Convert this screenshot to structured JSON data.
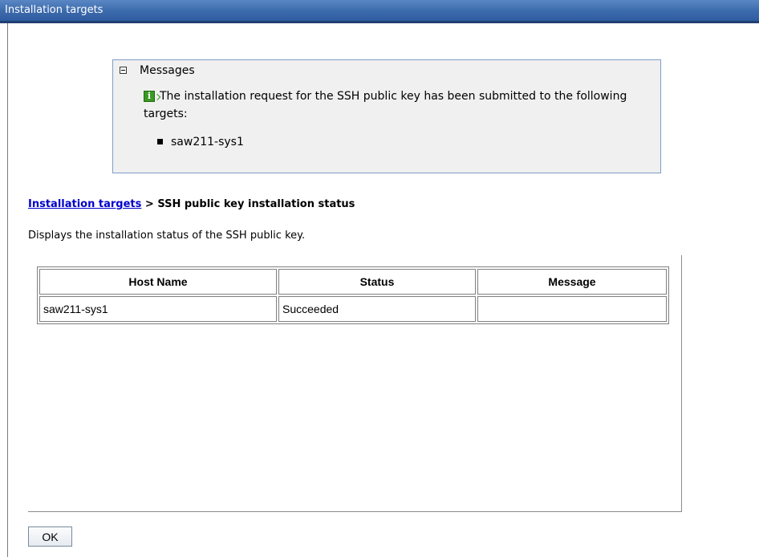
{
  "window": {
    "title": "Installation targets"
  },
  "messages": {
    "heading": "Messages",
    "text": "The installation request for the SSH public key has been submitted to the following targets:",
    "targets": [
      "saw211-sys1"
    ]
  },
  "breadcrumb": {
    "link": "Installation targets",
    "separator": " > ",
    "current": "SSH public key installation status"
  },
  "description": "Displays the installation status of the SSH public key.",
  "table": {
    "columns": [
      "Host Name",
      "Status",
      "Message"
    ],
    "rows": [
      [
        "saw211-sys1",
        "Succeeded",
        ""
      ]
    ]
  },
  "buttons": {
    "ok": "OK"
  },
  "colors": {
    "title_bar": "#3b6aac",
    "link": "#0000cc",
    "message_box_border": "#7f9dc9",
    "info_icon": "#3a9a23"
  }
}
